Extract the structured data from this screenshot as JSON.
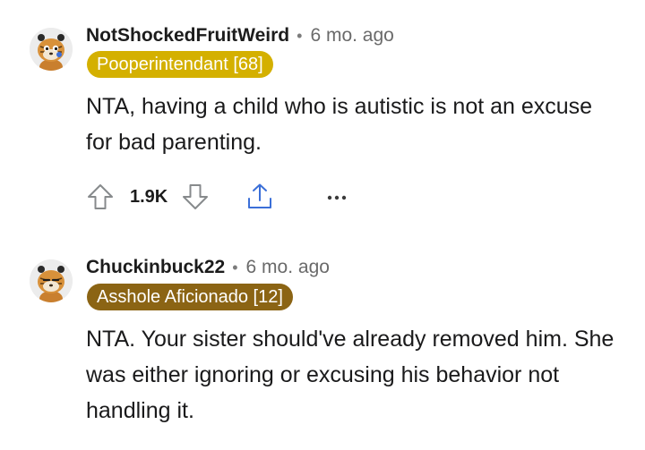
{
  "comments": [
    {
      "username": "NotShockedFruitWeird",
      "separator": "•",
      "age": "6 mo. ago",
      "flair": "Pooperintendant [68]",
      "flair_color": "#d4b000",
      "body": "NTA, having a child who is autistic is not an excuse for bad parenting.",
      "score": "1.9K",
      "upvote_icon": "arrow-up-outline-icon",
      "downvote_icon": "arrow-down-outline-icon",
      "share_icon": "share-icon",
      "more_icon": "ellipsis-icon"
    },
    {
      "username": "Chuckinbuck22",
      "separator": "•",
      "age": "6 mo. ago",
      "flair": "Asshole Aficionado [12]",
      "flair_color": "#8b6414",
      "body": "NTA. Your sister should've already removed him. She was either ignoring or excusing his behavior not handling it."
    }
  ]
}
